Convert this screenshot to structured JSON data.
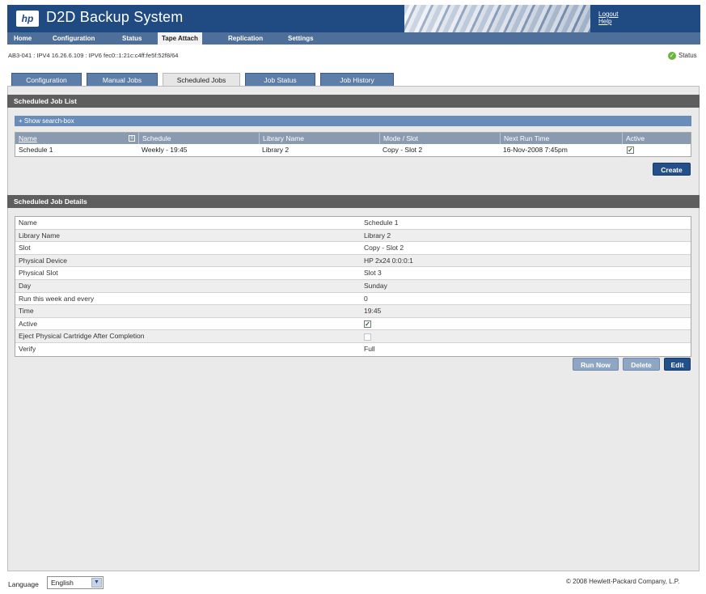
{
  "app": {
    "logo_text": "hp",
    "title": "D2D Backup System"
  },
  "header_links": {
    "logout": "Logout",
    "help": "Help"
  },
  "nav": [
    {
      "label": "Home"
    },
    {
      "label": "Configuration"
    },
    {
      "label": "Status"
    },
    {
      "label": "Tape Attach"
    },
    {
      "label": "Replication"
    },
    {
      "label": "Settings"
    }
  ],
  "ip_info": "AB3-041 : IPV4 16.26.6.109 : IPV6 fec0::1:21c:c4ff:fe5f:52f8/64",
  "status": {
    "icon": "check-circle-icon",
    "label": "Status"
  },
  "tabs": [
    {
      "label": "Configuration"
    },
    {
      "label": "Manual Jobs"
    },
    {
      "label": "Scheduled Jobs"
    },
    {
      "label": "Job Status"
    },
    {
      "label": "Job History"
    }
  ],
  "job_list": {
    "title": "Scheduled Job List",
    "search_toggle": "+ Show search-box",
    "columns": [
      "Name",
      "Schedule",
      "Library Name",
      "Mode / Slot",
      "Next Run Time",
      "Active"
    ],
    "rows": [
      {
        "name": "Schedule 1",
        "schedule": "Weekly - 19:45",
        "library": "Library 2",
        "mode_slot": "Copy  -  Slot 2",
        "next_run": "16-Nov-2008 7:45pm",
        "active": true
      }
    ],
    "create_label": "Create"
  },
  "job_details": {
    "title": "Scheduled Job Details",
    "rows": [
      {
        "label": "Name",
        "value": "Schedule 1"
      },
      {
        "label": "Library Name",
        "value": "Library 2"
      },
      {
        "label": "Slot",
        "value": "Copy  -  Slot 2"
      },
      {
        "label": "Physical Device",
        "value": "HP 2x24 0:0:0:1"
      },
      {
        "label": "Physical Slot",
        "value": "Slot 3"
      },
      {
        "label": "Day",
        "value": "Sunday"
      },
      {
        "label": "Run this week and every",
        "value": "0"
      },
      {
        "label": "Time",
        "value": "19:45"
      },
      {
        "label": "Active",
        "value": "",
        "checkbox": true
      },
      {
        "label": "Eject Physical Cartridge After Completion",
        "value": "",
        "checkbox": false
      },
      {
        "label": "Verify",
        "value": "Full"
      }
    ],
    "buttons": {
      "run_now": "Run Now",
      "delete": "Delete",
      "edit": "Edit"
    }
  },
  "footer": {
    "language_label": "Language",
    "language_value": "English",
    "copyright": "© 2008 Hewlett-Packard Company, L.P."
  },
  "colors": {
    "header_bg": "#1f4a82",
    "nav_bg": "#4d6f99",
    "tab_bg": "#5d7ea8",
    "section_bar": "#5e5e5e",
    "button": "#234f8a",
    "status_ok": "#6bb43f"
  }
}
